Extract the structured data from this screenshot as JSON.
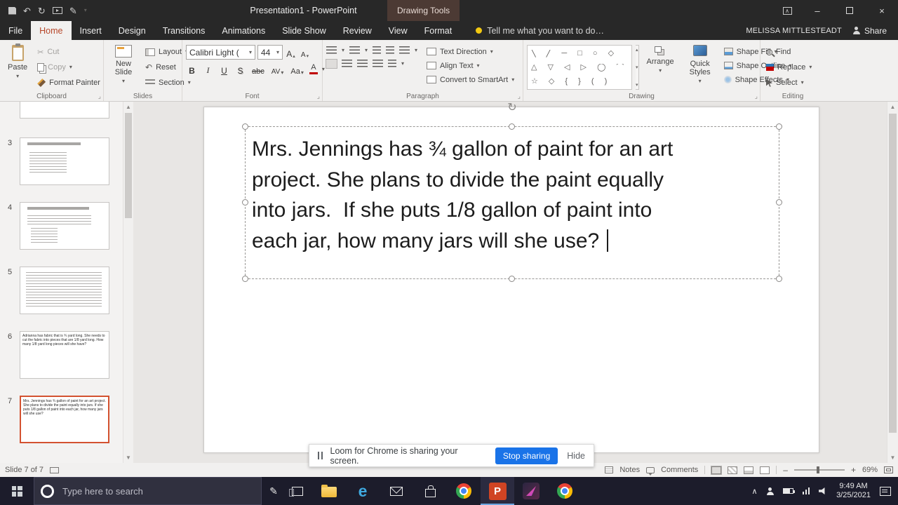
{
  "titlebar": {
    "title": "Presentation1 - PowerPoint",
    "context_tools_label": "Drawing Tools"
  },
  "tabs": {
    "file": "File",
    "home": "Home",
    "insert": "Insert",
    "design": "Design",
    "transitions": "Transitions",
    "animations": "Animations",
    "slide_show": "Slide Show",
    "review": "Review",
    "view": "View",
    "format": "Format"
  },
  "tellme_label": "Tell me what you want to do…",
  "account": {
    "user_name": "MELISSA MITTLESTEADT",
    "share_label": "Share"
  },
  "ribbon": {
    "clipboard": {
      "label": "Clipboard",
      "paste": "Paste",
      "cut": "Cut",
      "copy": "Copy",
      "format_painter": "Format Painter"
    },
    "slides": {
      "label": "Slides",
      "new_slide": "New Slide",
      "layout": "Layout",
      "reset": "Reset",
      "section": "Section"
    },
    "font": {
      "label": "Font",
      "font_name": "Calibri Light (",
      "font_size": "44",
      "bold": "B",
      "italic": "I",
      "underline": "U",
      "shadow": "S",
      "strikethrough": "abc",
      "char_spacing": "AV",
      "change_case": "Aa",
      "font_color": "A"
    },
    "paragraph": {
      "label": "Paragraph",
      "text_direction": "Text Direction",
      "align_text": "Align Text",
      "smartart": "Convert to SmartArt"
    },
    "drawing": {
      "label": "Drawing",
      "arrange": "Arrange",
      "quick_styles": "Quick Styles",
      "shape_fill": "Shape Fill",
      "shape_outline": "Shape Outline",
      "shape_effects": "Shape Effects",
      "shapes_row1": "╲ ╱ ─ □ ○ ◇",
      "shapes_row2": "△ ▽ ◁ ▷ ◯ ⌒",
      "shapes_row3": "☆ ◇ { } ( )"
    },
    "editing": {
      "label": "Editing",
      "find": "Find",
      "replace": "Replace",
      "select": "Select"
    }
  },
  "slides_panel": {
    "numbers": [
      "3",
      "4",
      "5",
      "6",
      "7"
    ],
    "slide6_preview": "Adrianna has fabric that is ¾ yard long. She needs to cut the fabric into pieces that are 1/8 yard long.  How many 1/8 yard long pieces will she have?",
    "slide7_preview": "Mrs. Jennings has ¾ gallon of paint for an art project.  She plans to divide the paint equally into jars.  If she puts 1/8 gallon of paint into each jar, how many jars will she use?"
  },
  "slide": {
    "line1": "Mrs. Jennings has ¾ gallon of paint for an art",
    "line2": "project. She plans to divide the paint equally",
    "line3": "into jars.  If she puts 1/8 gallon of paint into",
    "line4": "each jar, how many jars will she use? "
  },
  "loom_banner": {
    "message": "Loom for Chrome is sharing your screen.",
    "stop_button": "Stop sharing",
    "hide_button": "Hide"
  },
  "status_bar": {
    "slide_indicator": "Slide 7 of 7",
    "notes_label": "Notes",
    "comments_label": "Comments",
    "zoom_level": "69%",
    "zoom_minus": "–",
    "zoom_plus": "+"
  },
  "taskbar": {
    "search_placeholder": "Type here to search",
    "clock_time": "9:49 AM",
    "clock_date": "3/25/2021"
  },
  "icons": {
    "caret_down": "▾",
    "caret_up": "▴",
    "undo": "↶",
    "redo": "↻",
    "cut": "✂",
    "scroll_up": "▲",
    "scroll_down": "▼",
    "close": "×",
    "minimize": "–",
    "chevron_up": "∧",
    "rotate": "↻",
    "pen": "✎",
    "launcher": "⌟",
    "a_big": "A",
    "a_small": "A"
  },
  "colors": {
    "accent": "#B7472A",
    "loom_blue": "#1A73E8",
    "selection": "#D35230",
    "ppt_orange": "#D04423"
  }
}
